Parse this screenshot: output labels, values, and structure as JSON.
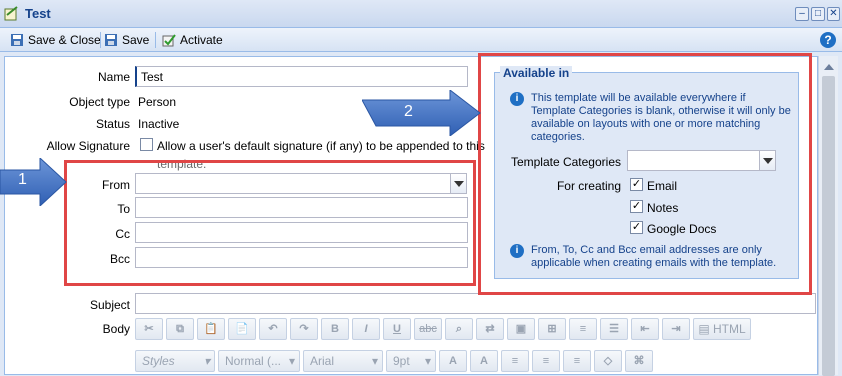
{
  "window": {
    "title": "Test"
  },
  "toolbar": {
    "save_close": "Save & Close",
    "save": "Save",
    "activate": "Activate"
  },
  "form": {
    "name_label": "Name",
    "name_value": "Test",
    "object_type_label": "Object type",
    "object_type_value": "Person",
    "status_label": "Status",
    "status_value": "Inactive",
    "allow_signature_label": "Allow Signature",
    "allow_signature_text_1": "Allow a user's default signature (if any) to be appended to this",
    "allow_signature_text_2": "template.",
    "from_label": "From",
    "to_label": "To",
    "cc_label": "Cc",
    "bcc_label": "Bcc",
    "subject_label": "Subject",
    "body_label": "Body"
  },
  "available_in": {
    "legend": "Available in",
    "info_1": "This template will be available everywhere if Template Categories is blank, otherwise it will only be available on layouts with one or more matching categories.",
    "template_categories_label": "Template Categories",
    "for_creating_label": "For creating",
    "options": [
      {
        "label": "Email",
        "checked": true
      },
      {
        "label": "Notes",
        "checked": true
      },
      {
        "label": "Google Docs",
        "checked": true
      }
    ],
    "info_2": "From, To, Cc and Bcc email addresses are only applicable when creating emails with the template."
  },
  "annotations": {
    "arrow_1": "1",
    "arrow_2": "2"
  },
  "editor": {
    "html_label": "HTML",
    "styles": "Styles",
    "format": "Normal (...",
    "font": "Arial",
    "size": "9pt",
    "bold": "B",
    "italic": "I",
    "underline": "U",
    "strike": "abc"
  },
  "colors": {
    "accent": "#15428b",
    "annotation_red": "#e04646",
    "arrow_blue": "#3f6fc4"
  }
}
